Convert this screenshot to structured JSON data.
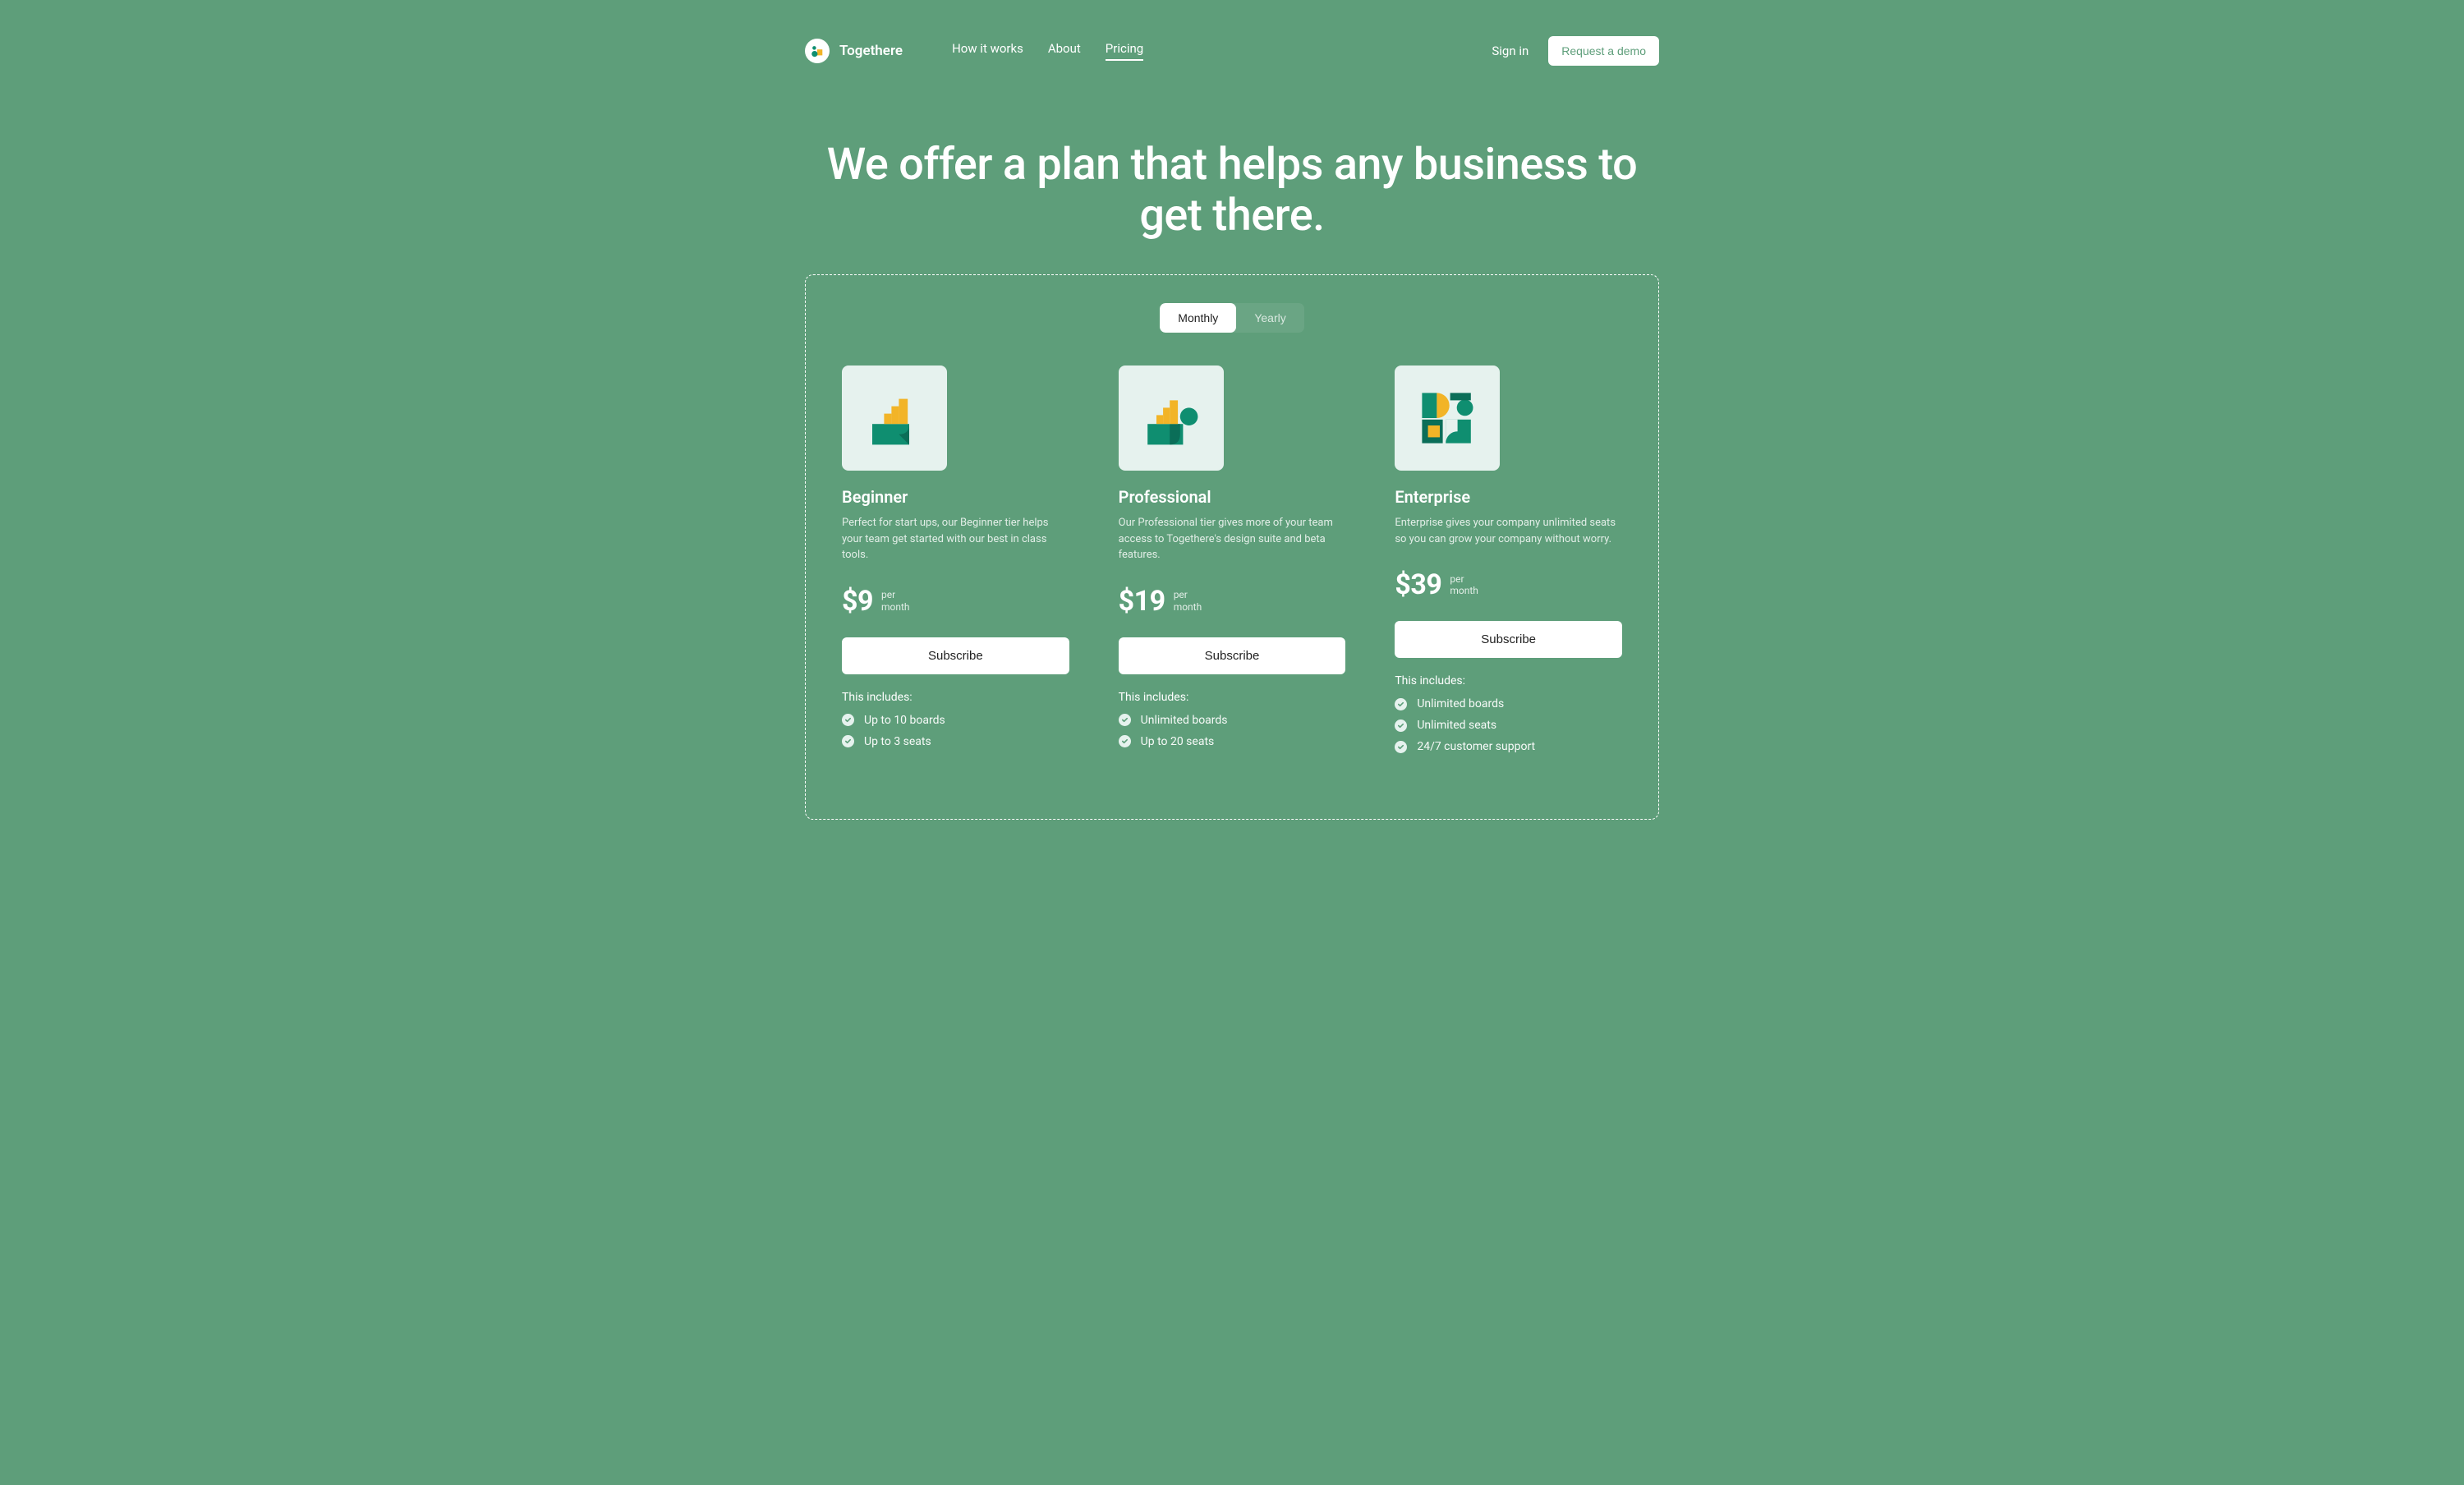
{
  "brand": {
    "name": "Togethere"
  },
  "nav": {
    "items": [
      {
        "label": "How it works",
        "active": false
      },
      {
        "label": "About",
        "active": false
      },
      {
        "label": "Pricing",
        "active": true
      }
    ],
    "signin": "Sign in",
    "demo": "Request a demo"
  },
  "hero": {
    "title": "We offer a plan that helps any business to get there."
  },
  "billing_toggle": {
    "options": [
      {
        "label": "Monthly",
        "active": true
      },
      {
        "label": "Yearly",
        "active": false
      }
    ]
  },
  "pricing": {
    "per_line1": "per",
    "per_line2": "month",
    "subscribe_label": "Subscribe",
    "includes_label": "This includes:",
    "plans": [
      {
        "name": "Beginner",
        "desc": "Perfect for start ups, our Beginner tier helps your team get started with our best in class tools.",
        "price": "$9",
        "features": [
          "Up to 10 boards",
          "Up to 3 seats"
        ]
      },
      {
        "name": "Professional",
        "desc": "Our Professional tier gives more of your team access to Togethere's design suite and beta features.",
        "price": "$19",
        "features": [
          "Unlimited boards",
          "Up to 20 seats"
        ]
      },
      {
        "name": "Enterprise",
        "desc": "Enterprise gives your company unlimited seats so you can grow your company without worry.",
        "price": "$39",
        "features": [
          "Unlimited boards",
          "Unlimited seats",
          "24/7 customer support"
        ]
      }
    ]
  }
}
